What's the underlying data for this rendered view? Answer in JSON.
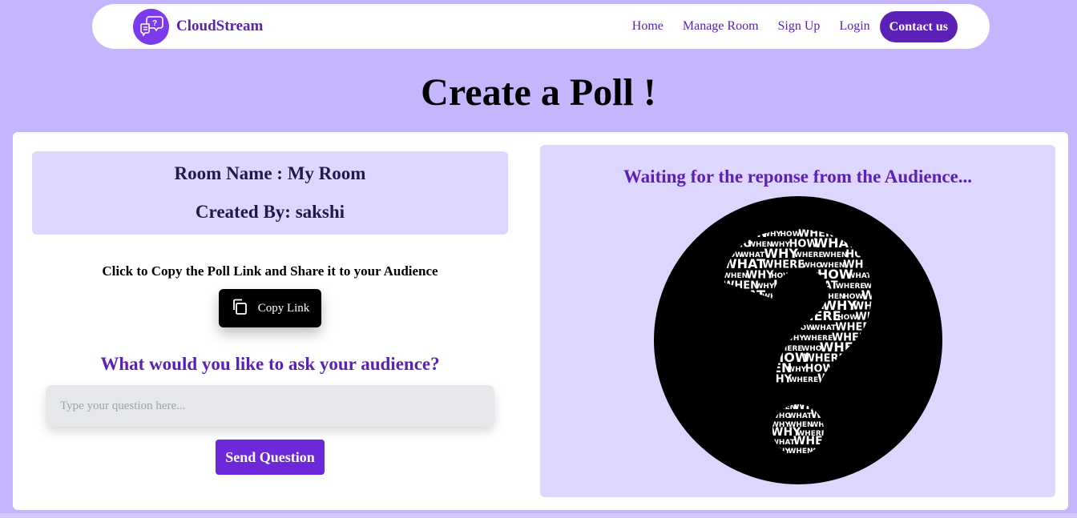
{
  "navbar": {
    "brand": "CloudStream",
    "logo_icon": "chat-question-icon",
    "links": [
      "Home",
      "Manage Room",
      "Sign Up",
      "Login"
    ],
    "contact_label": "Contact us"
  },
  "page": {
    "title": "Create a Poll !"
  },
  "room": {
    "name_line": "Room Name : My Room",
    "created_by_line": "Created By: sakshi"
  },
  "share": {
    "instruction": "Click to Copy the Poll Link and Share it to your Audience",
    "copy_label": "Copy Link",
    "copy_icon": "copy-icon"
  },
  "question": {
    "heading": "What would you like to ask your audience?",
    "placeholder": "Type your question here...",
    "value": "",
    "send_label": "Send Question"
  },
  "response": {
    "waiting_text": "Waiting for the reponse from the Audience...",
    "image": "question-mark-word-cloud-icon"
  },
  "word_cloud": {
    "words_top": [
      "WHEN",
      "WHY",
      "HOW",
      "WHERE",
      "HOW",
      "WHAT",
      "WHO",
      "WHEN",
      "WHY",
      "HOW",
      "WHAT",
      "WHERE",
      "WHO",
      "HOW",
      "WHAT",
      "WHY",
      "WHERE",
      "WHEN",
      "HOW",
      "WHY",
      "WHAT",
      "WHERE",
      "WHO",
      "WHEN",
      "WHY",
      "WHERE"
    ],
    "words_dot": [
      "WHEN",
      "WHY",
      "WHERE",
      "WHO",
      "WHAT",
      "WHERE",
      "WHY",
      "WHEN"
    ]
  },
  "colors": {
    "background": "#c4b5fd",
    "accent": "#5b21b6",
    "panel": "#ddd6fe",
    "button": "#6d28d9"
  }
}
